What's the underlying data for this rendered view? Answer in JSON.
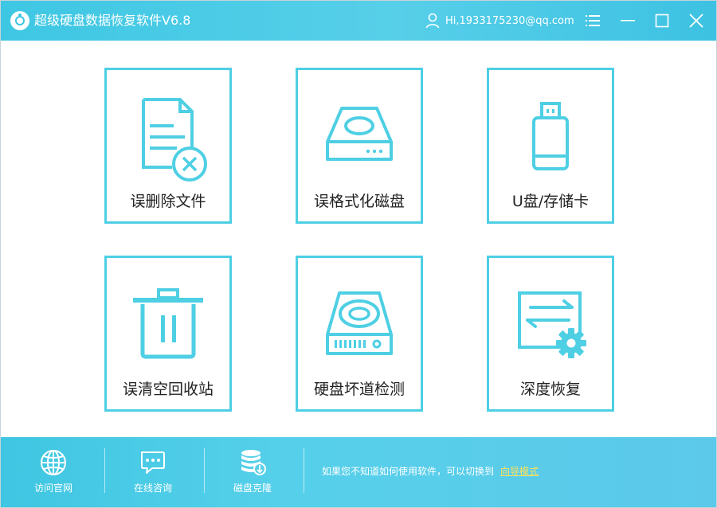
{
  "window": {
    "title": "超级硬盘数据恢复软件V6.8",
    "user": "Hi,1933175230@qq.com",
    "controls": [
      "menu-icon",
      "minimize-icon",
      "maximize-icon",
      "close-icon"
    ]
  },
  "tiles": [
    {
      "label": "误删除文件",
      "icon": "deleted-file-icon"
    },
    {
      "label": "误格式化磁盘",
      "icon": "formatted-disk-icon"
    },
    {
      "label": "U盘/存储卡",
      "icon": "usb-drive-icon"
    },
    {
      "label": "误清空回收站",
      "icon": "recycle-bin-icon"
    },
    {
      "label": "硬盘坏道检测",
      "icon": "disk-check-icon"
    },
    {
      "label": "深度恢复",
      "icon": "deep-recovery-icon"
    }
  ],
  "bottom": {
    "items": [
      {
        "label": "访问官网",
        "icon": "globe-icon"
      },
      {
        "label": "在线咨询",
        "icon": "chat-icon"
      },
      {
        "label": "磁盘克隆",
        "icon": "database-clone-icon"
      }
    ],
    "hint": "如果您不知道如何使用软件，可以切换到",
    "link": "向导模式"
  },
  "colors": {
    "accent": "#4ecfe4",
    "titlebar": "#3ec7e3",
    "link": "#ffe25a"
  }
}
